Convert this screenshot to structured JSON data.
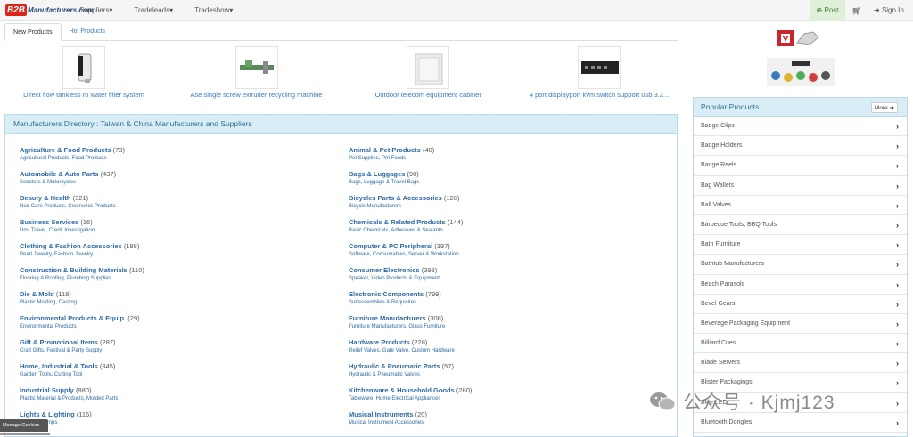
{
  "nav": {
    "logo_b2b": "B2B",
    "logo_rest": "Manufacturers.com",
    "menu": [
      {
        "label": "Suppliers▾"
      },
      {
        "label": "Tradeleads▾"
      },
      {
        "label": "Tradeshow▾"
      }
    ],
    "post": "Post",
    "signin": "Sign In"
  },
  "tabs": [
    "New Products",
    "Hot Products"
  ],
  "products": [
    {
      "name": "Direct flow tankless ro water filter system"
    },
    {
      "name": "Ase single screw extruder recycling machine"
    },
    {
      "name": "Outdoor telecom equipment cabinet"
    },
    {
      "name": "4 port displayport kvm switch support usb 3.2..."
    }
  ],
  "directory": {
    "title": "Manufacturers Directory : Taiwan & China Manufacturers and Suppliers",
    "left": [
      {
        "name": "Agriculture & Food Products",
        "count": "(73)",
        "sub": "Agricultural Products, Food Products"
      },
      {
        "name": "Automobile & Auto Parts",
        "count": "(437)",
        "sub": "Scooters & Motorcycles"
      },
      {
        "name": "Beauty & Health",
        "count": "(321)",
        "sub": "Hair Care Products, Cosmetics Products"
      },
      {
        "name": "Business Services",
        "count": "(16)",
        "sub": "Urn, Travel, Credit Investigation"
      },
      {
        "name": "Clothing & Fashion Accessories",
        "count": "(188)",
        "sub": "Pearl Jewelry, Fashion Jewelry"
      },
      {
        "name": "Construction & Building Materials",
        "count": "(110)",
        "sub": "Flooring & Roofing, Plumbing Supplies"
      },
      {
        "name": "Die & Mold",
        "count": "(118)",
        "sub": "Plastic Molding, Casting"
      },
      {
        "name": "Environmental Products & Equip.",
        "count": "(29)",
        "sub": "Environmental Products"
      },
      {
        "name": "Gift & Promotional Items",
        "count": "(287)",
        "sub": "Craft Gifts, Festival & Party Supply"
      },
      {
        "name": "Home, Industrial & Tools",
        "count": "(345)",
        "sub": "Garden Tools, Cutting Tool"
      },
      {
        "name": "Industrial Supply",
        "count": "(880)",
        "sub": "Plastic Material & Products, Molded Parts"
      },
      {
        "name": "Lights & Lighting",
        "count": "(116)",
        "sub": "Lighting, Lamps"
      }
    ],
    "right": [
      {
        "name": "Animal & Pet Products",
        "count": "(40)",
        "sub": "Pet Supplies, Pet Foods"
      },
      {
        "name": "Bags & Luggages",
        "count": "(90)",
        "sub": "Bags, Luggage & Travel Bags"
      },
      {
        "name": "Bicycles Parts & Accessories",
        "count": "(128)",
        "sub": "Bicycle Manufacturers"
      },
      {
        "name": "Chemicals & Related Products",
        "count": "(144)",
        "sub": "Basic Chemicals, Adhesives & Sealants"
      },
      {
        "name": "Computer & PC Peripheral",
        "count": "(397)",
        "sub": "Software, Consumables, Server & Workstation"
      },
      {
        "name": "Consumer Electronics",
        "count": "(398)",
        "sub": "Speaker, Video Products & Equipment"
      },
      {
        "name": "Electronic Components",
        "count": "(799)",
        "sub": "Subassemblies & Requisites"
      },
      {
        "name": "Furniture Manufacturers",
        "count": "(308)",
        "sub": "Furniture Manufacturers, Glass Furniture"
      },
      {
        "name": "Hardware Products",
        "count": "(228)",
        "sub": "Relief Valves, Gate Valve, Custom Hardware"
      },
      {
        "name": "Hydraulic & Pneumatic Parts",
        "count": "(57)",
        "sub": "Hydraulic & Pneumatic Valves"
      },
      {
        "name": "Kitchenware & Household Goods",
        "count": "(280)",
        "sub": "Tableware, Home Electrical Appliances"
      },
      {
        "name": "Musical Instruments",
        "count": "(20)",
        "sub": "Musical Instrument Accessories"
      }
    ]
  },
  "popular": {
    "title": "Popular Products",
    "more": "More",
    "items": [
      "Badge Clips",
      "Badge Holders",
      "Badge Reels",
      "Bag Wallets",
      "Ball Valves",
      "Barbecue Tools, BBQ Tools",
      "Bath Furniture",
      "Bathtub Manufacturers",
      "Beach Parasols",
      "Bevel Gears",
      "Beverage Packaging Equipment",
      "Billiard Cues",
      "Blade Servers",
      "Blister Packagings",
      "Blue LED",
      "Bluetooth Dongles"
    ]
  },
  "manage_cookies": "Manage Cookies",
  "watermark": "公众号 · Kjmj123"
}
